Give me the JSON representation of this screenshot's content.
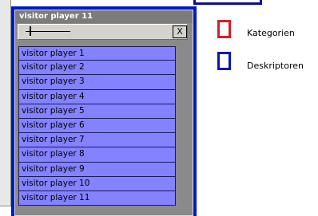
{
  "window": {
    "title": "visitor player 11",
    "close_label": "X",
    "slider_level": 0.09
  },
  "players": [
    "visitor player 1",
    "visitor player 2",
    "visitor player 3",
    "visitor player 4",
    "visitor player 5",
    "visitor player 6",
    "visitor player 7",
    "visitor player 8",
    "visitor player 9",
    "visitor player 10",
    "visitor player 11"
  ],
  "legend": {
    "items": [
      {
        "label": "Kategorien",
        "color": "#d0202a"
      },
      {
        "label": "Deskriptoren",
        "color": "#0018b4"
      }
    ]
  },
  "colors": {
    "selection_border": "#0018c8",
    "list_item_background": "#8482ff"
  }
}
